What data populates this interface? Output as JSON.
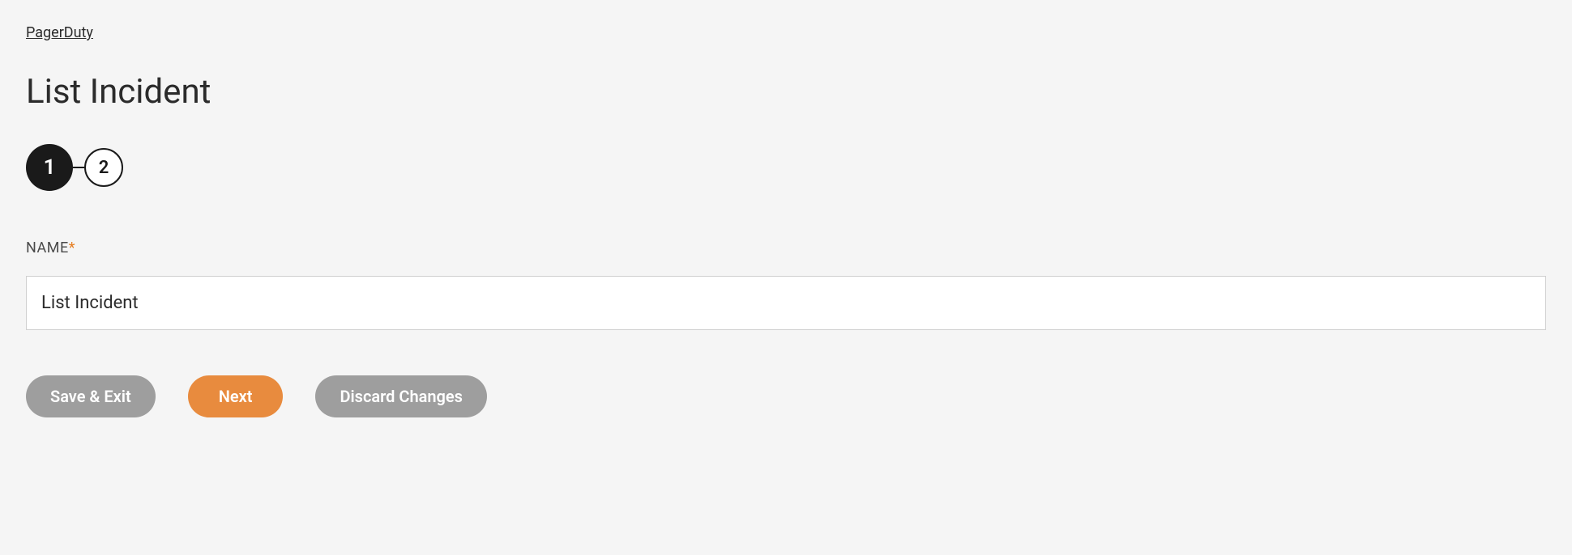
{
  "breadcrumb": {
    "label": "PagerDuty"
  },
  "page": {
    "title": "List Incident"
  },
  "stepper": {
    "step1": "1",
    "step2": "2"
  },
  "form": {
    "name_label": "NAME",
    "required_mark": "*",
    "name_value": "List Incident"
  },
  "buttons": {
    "save_exit": "Save & Exit",
    "next": "Next",
    "discard": "Discard Changes"
  }
}
